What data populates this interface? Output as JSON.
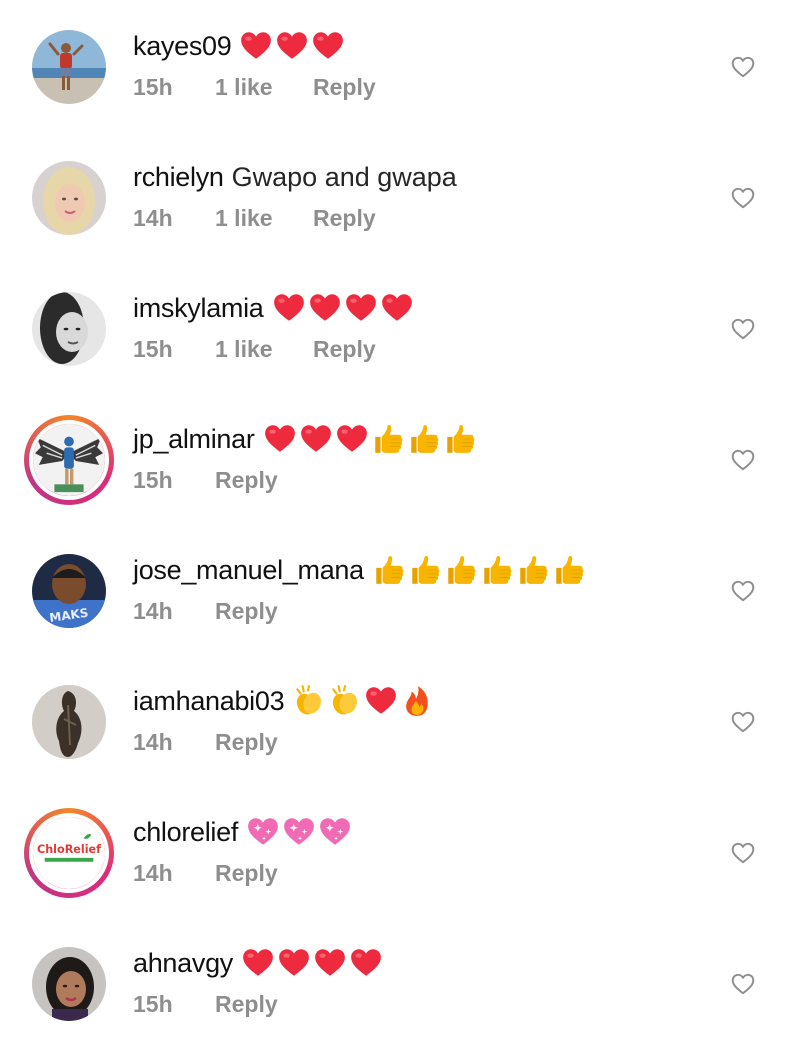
{
  "comments": [
    {
      "username": "kayes09",
      "text": "",
      "emojis": [
        "red-heart",
        "red-heart",
        "red-heart"
      ],
      "time": "15h",
      "likes": "1 like",
      "reply": "Reply",
      "avatar": "beach-photo",
      "ring": false
    },
    {
      "username": "rchielyn",
      "text": "Gwapo and gwapa",
      "emojis": [],
      "time": "14h",
      "likes": "1 like",
      "reply": "Reply",
      "avatar": "blonde-woman",
      "ring": false
    },
    {
      "username": "imskylamia",
      "text": "",
      "emojis": [
        "red-heart",
        "red-heart",
        "red-heart",
        "red-heart"
      ],
      "time": "15h",
      "likes": "1 like",
      "reply": "Reply",
      "avatar": "bw-woman",
      "ring": false
    },
    {
      "username": "jp_alminar",
      "text": "",
      "emojis": [
        "red-heart",
        "red-heart",
        "red-heart",
        "thumbs-up",
        "thumbs-up",
        "thumbs-up"
      ],
      "time": "15h",
      "likes": "",
      "reply": "Reply",
      "avatar": "winged-figure",
      "ring": true
    },
    {
      "username": "jose_manuel_mana",
      "text": "",
      "emojis": [
        "thumbs-up",
        "thumbs-up",
        "thumbs-up",
        "thumbs-up",
        "thumbs-up",
        "thumbs-up"
      ],
      "time": "14h",
      "likes": "",
      "reply": "Reply",
      "avatar": "man-blue-shirt",
      "ring": false
    },
    {
      "username": "iamhanabi03",
      "text": "",
      "emojis": [
        "clapping-hands",
        "clapping-hands",
        "red-heart",
        "fire"
      ],
      "time": "14h",
      "likes": "",
      "reply": "Reply",
      "avatar": "dark-figure",
      "ring": false
    },
    {
      "username": "chlorelief",
      "text": "",
      "emojis": [
        "sparkling-heart",
        "sparkling-heart",
        "sparkling-heart"
      ],
      "time": "14h",
      "likes": "",
      "reply": "Reply",
      "avatar": "chlorelief-logo",
      "avatar_text": "ChloRelief",
      "ring": true
    },
    {
      "username": "ahnavgy",
      "text": "",
      "emojis": [
        "red-heart",
        "red-heart",
        "red-heart",
        "red-heart"
      ],
      "time": "15h",
      "likes": "",
      "reply": "Reply",
      "avatar": "woman-portrait",
      "ring": false
    }
  ],
  "colors": {
    "meta": "#8e8e8e",
    "heart": "#ed2a3e",
    "thumb": "#f7b500",
    "sparkle_heart": "#f06ab4",
    "like_outline": "#8e8e8e",
    "brand_green": "#3aa64b",
    "brand_red": "#e53935"
  }
}
